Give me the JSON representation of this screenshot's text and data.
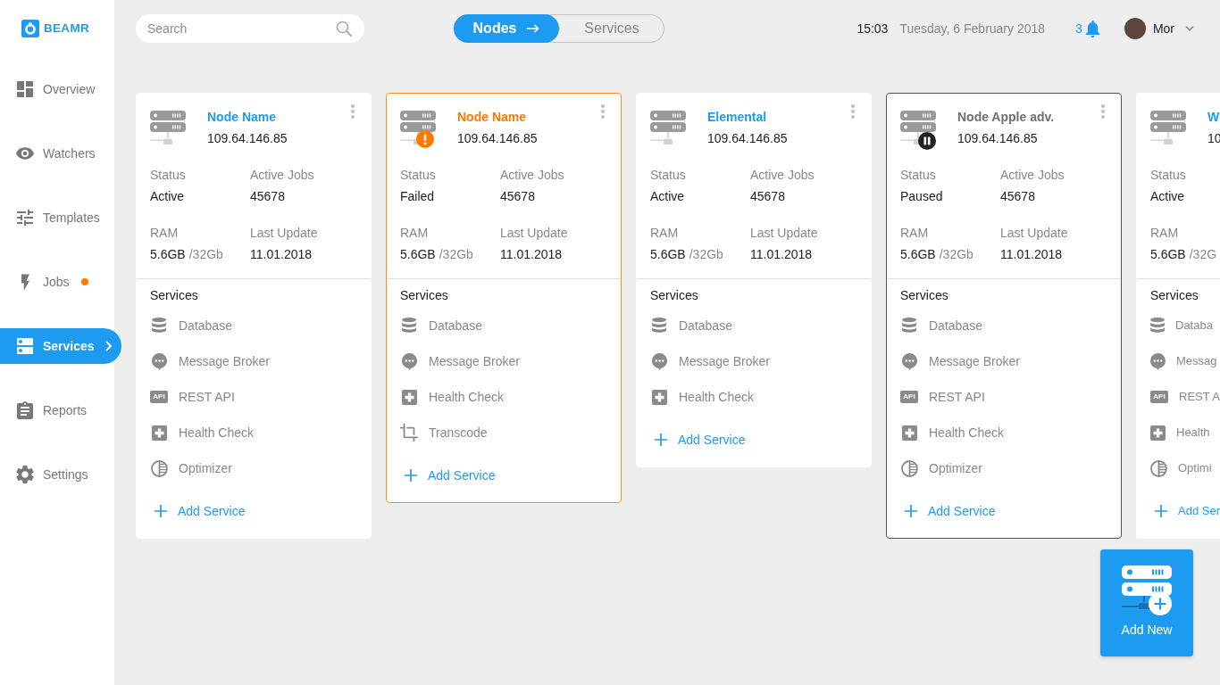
{
  "sidebar": {
    "logo": "BEAMR",
    "items": [
      {
        "kind": "overview",
        "label": "Overview",
        "selected": false,
        "alert": false
      },
      {
        "kind": "watchers",
        "label": "Watchers",
        "selected": false,
        "alert": false
      },
      {
        "kind": "templates",
        "label": "Templates",
        "selected": false,
        "alert": false
      },
      {
        "kind": "jobs",
        "label": "Jobs",
        "selected": false,
        "alert": true
      },
      {
        "kind": "services",
        "label": "Services",
        "selected": true,
        "alert": false
      },
      {
        "kind": "reports",
        "label": "Reports",
        "selected": false,
        "alert": false
      },
      {
        "kind": "settings",
        "label": "Settings",
        "selected": false,
        "alert": false
      }
    ]
  },
  "topbar": {
    "search": {
      "placeholder": "Search"
    },
    "view_switch": [
      {
        "label": "Nodes",
        "selected": true
      },
      {
        "label": "Services",
        "selected": false
      }
    ],
    "time": "15:03",
    "date": "Tuesday, 6 February 2018",
    "notifications": "3",
    "user": "Mor"
  },
  "nodes": [
    {
      "name": "Node Name",
      "ip": "109.64.146.85",
      "failed": false,
      "paused": false,
      "selected": false,
      "detail_rows": [
        [
          {
            "label": "Status",
            "value": "Active"
          },
          {
            "label": "Active Jobs",
            "value": "45678"
          }
        ],
        [
          {
            "label": "RAM",
            "value": "5.6GB",
            "total": "/32Gb"
          },
          {
            "label": "Last Update",
            "value": "11.01.2018"
          }
        ]
      ],
      "services_title": "Services",
      "services": [
        {
          "kind": "database",
          "label": "Database"
        },
        {
          "kind": "message",
          "label": "Message Broker"
        },
        {
          "kind": "api",
          "label": "REST API",
          "tag": "API"
        },
        {
          "kind": "health",
          "label": "Health Check"
        },
        {
          "kind": "optimizer",
          "label": "Optimizer"
        }
      ],
      "add_service": "Add Service"
    },
    {
      "name": "Node Name",
      "ip": "109.64.146.85",
      "failed": true,
      "paused": false,
      "selected": false,
      "detail_rows": [
        [
          {
            "label": "Status",
            "value": "Failed"
          },
          {
            "label": "Active Jobs",
            "value": "45678"
          }
        ],
        [
          {
            "label": "RAM",
            "value": "5.6GB",
            "total": "/32Gb"
          },
          {
            "label": "Last Update",
            "value": "11.01.2018"
          }
        ]
      ],
      "services_title": "Services",
      "services": [
        {
          "kind": "database",
          "label": "Database"
        },
        {
          "kind": "message",
          "label": "Message Broker"
        },
        {
          "kind": "health",
          "label": "Health Check"
        },
        {
          "kind": "transcode",
          "label": "Transcode"
        }
      ],
      "add_service": "Add Service"
    },
    {
      "name": "Elemental",
      "ip": "109.64.146.85",
      "failed": false,
      "paused": false,
      "selected": false,
      "detail_rows": [
        [
          {
            "label": "Status",
            "value": "Active"
          },
          {
            "label": "Active Jobs",
            "value": "45678"
          }
        ],
        [
          {
            "label": "RAM",
            "value": "5.6GB",
            "total": "/32Gb"
          },
          {
            "label": "Last Update",
            "value": "11.01.2018"
          }
        ]
      ],
      "services_title": "Services",
      "services": [
        {
          "kind": "database",
          "label": "Database"
        },
        {
          "kind": "message",
          "label": "Message Broker"
        },
        {
          "kind": "health",
          "label": "Health Check"
        }
      ],
      "add_service": "Add Service"
    },
    {
      "name": "Node Apple adv.",
      "ip": "109.64.146.85",
      "failed": false,
      "paused": true,
      "selected": true,
      "detail_rows": [
        [
          {
            "label": "Status",
            "value": "Paused"
          },
          {
            "label": "Active Jobs",
            "value": "45678"
          }
        ],
        [
          {
            "label": "RAM",
            "value": "5.6GB",
            "total": "/32Gb"
          },
          {
            "label": "Last Update",
            "value": "11.01.2018"
          }
        ]
      ],
      "services_title": "Services",
      "services": [
        {
          "kind": "database",
          "label": "Database"
        },
        {
          "kind": "message",
          "label": "Message Broker"
        },
        {
          "kind": "api",
          "label": "REST API",
          "tag": "API"
        },
        {
          "kind": "health",
          "label": "Health Check"
        },
        {
          "kind": "optimizer",
          "label": "Optimizer"
        }
      ],
      "add_service": "Add Service"
    },
    {
      "name": "W",
      "ip": "10",
      "failed": false,
      "paused": false,
      "selected": false,
      "detail_rows": [
        [
          {
            "label": "Status",
            "value": "Active"
          }
        ],
        [
          {
            "label": "RAM",
            "value": "5.6GB",
            "total": "/32G"
          }
        ]
      ],
      "services_title": "Services",
      "services": [
        {
          "kind": "database",
          "label": "Databa"
        },
        {
          "kind": "message",
          "label": "Messag"
        },
        {
          "kind": "api",
          "label": "REST A",
          "tag": "API"
        },
        {
          "kind": "health",
          "label": "Health"
        },
        {
          "kind": "optimizer",
          "label": "Optimi"
        }
      ],
      "add_service": "Add Ser"
    }
  ],
  "add_new": "Add New"
}
